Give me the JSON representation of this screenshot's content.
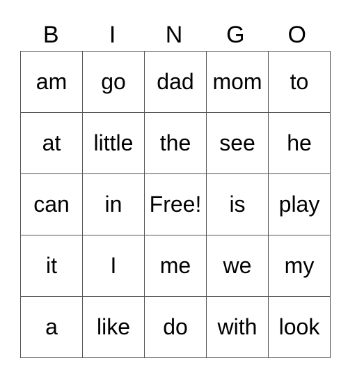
{
  "header": [
    "B",
    "I",
    "N",
    "G",
    "O"
  ],
  "rows": [
    [
      "am",
      "go",
      "dad",
      "mom",
      "to"
    ],
    [
      "at",
      "little",
      "the",
      "see",
      "he"
    ],
    [
      "can",
      "in",
      "Free!",
      "is",
      "play"
    ],
    [
      "it",
      "I",
      "me",
      "we",
      "my"
    ],
    [
      "a",
      "like",
      "do",
      "with",
      "look"
    ]
  ]
}
